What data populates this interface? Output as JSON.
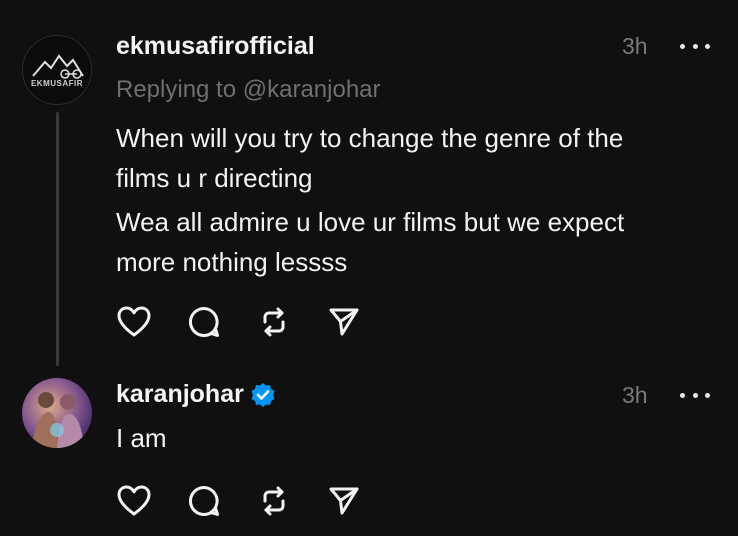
{
  "thread": {
    "parent": {
      "username": "ekmusafirofficial",
      "avatar_text": "EKMUSAFIR",
      "time": "3h",
      "replying_to": "Replying to @karanjohar",
      "lines": [
        "When will you try to change the genre of the",
        "films u r directing",
        "Wea all admire u love ur films but we expect",
        "more nothing lessss"
      ]
    },
    "reply": {
      "username": "karanjohar",
      "verified": true,
      "time": "3h",
      "text": "I am"
    }
  },
  "actions": {
    "like_icon": "heart-icon",
    "comment_icon": "comment-icon",
    "repost_icon": "repost-icon",
    "share_icon": "send-icon"
  },
  "colors": {
    "background": "#101010",
    "text": "#f5f5f5",
    "muted": "#6f6f6f",
    "verified": "#0095f6"
  }
}
